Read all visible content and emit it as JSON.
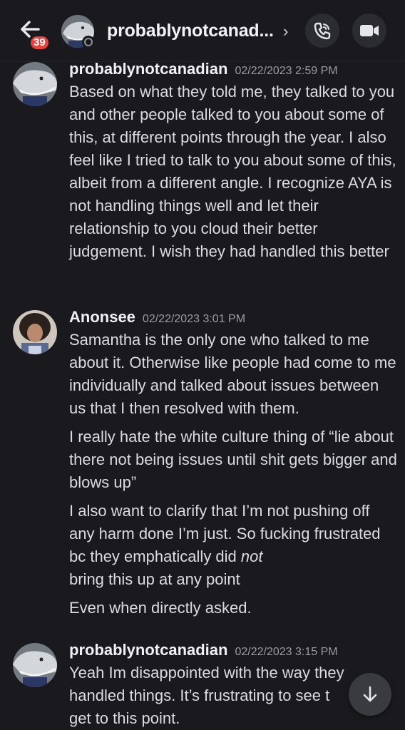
{
  "header": {
    "unread_count": "39",
    "title": "probablynotcanad...",
    "chevron": "›",
    "call_icon": "phone-icon",
    "video_icon": "video-camera-icon",
    "back_icon": "back-arrow-icon"
  },
  "messages": [
    {
      "author": "probablynotcanadian",
      "timestamp": "02/22/2023 2:59 PM",
      "paragraphs": [
        "Based on what they told me, they talked to you and other people talked to you about some of this, at different points through the year. I also feel like I tried to talk to you about some of this, albeit from a different angle. I recognize AYA is not handling things well and let their relationship to you cloud their better judgement. I wish they had handled this better"
      ]
    },
    {
      "author": "Anonsee",
      "timestamp": "02/22/2023 3:01 PM",
      "paragraphs": [
        "Samantha is the only one who talked to me about it. Otherwise like people had come to me individually and talked about issues between us that I then resolved with them.",
        "I really hate the white culture thing of “lie about there not being issues until shit gets bigger and blows up”",
        "I also want to clarify that I’m not pushing off any harm done I’m just. So fucking frustrated bc they emphatically did",
        "not",
        "bring this up at any point",
        "Even when directly asked."
      ]
    },
    {
      "author": "probablynotcanadian",
      "timestamp": "02/22/2023 3:15 PM",
      "paragraphs": [
        "Yeah Im disappointed with the way they handled things. It’s frustrating to see t",
        "get to this point."
      ]
    }
  ],
  "colors": {
    "background": "#1a1a1e",
    "badge": "#e8423f",
    "text": "#dbdcdf",
    "timestamp": "#9a9ca3"
  },
  "scroll_icon": "arrow-down-icon"
}
